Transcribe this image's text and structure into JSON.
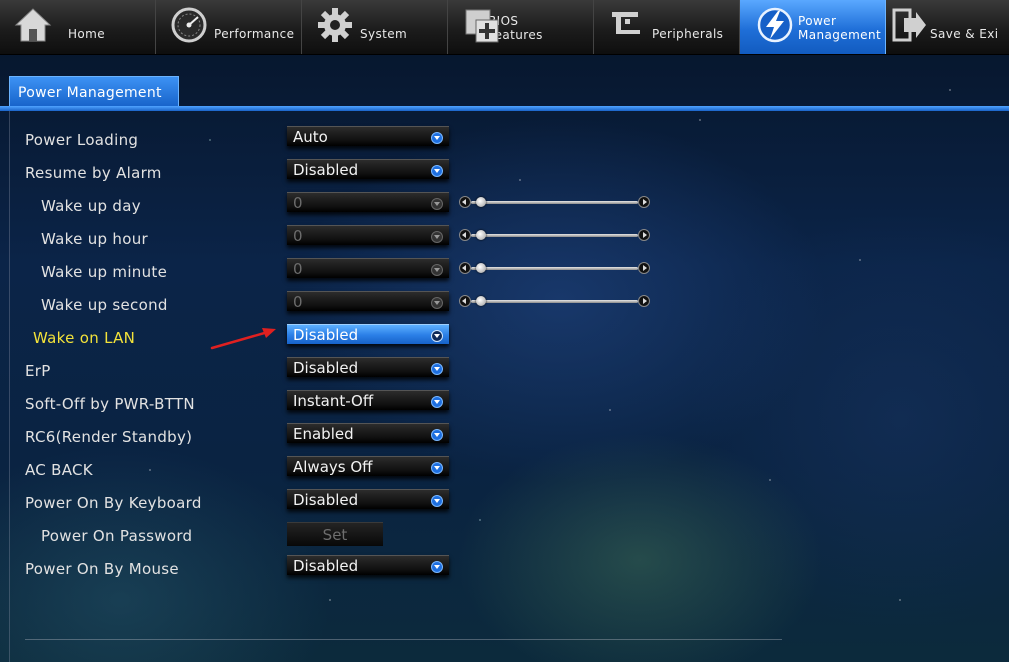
{
  "nav": {
    "tabs": [
      {
        "label1": "Home",
        "label2": ""
      },
      {
        "label1": "Performance",
        "label2": ""
      },
      {
        "label1": "System",
        "label2": ""
      },
      {
        "label1": "BIOS",
        "label2": "Features"
      },
      {
        "label1": "Peripherals",
        "label2": ""
      },
      {
        "label1": "Power",
        "label2": "Management"
      },
      {
        "label1": "Save & Exi",
        "label2": ""
      }
    ],
    "active_index": 5
  },
  "section_tab": "Power Management",
  "settings": [
    {
      "label": "Power Loading",
      "value": "Auto"
    },
    {
      "label": "Resume by Alarm",
      "value": "Disabled"
    },
    {
      "label": "Wake up day",
      "value": "0",
      "slider": 0
    },
    {
      "label": "Wake up hour",
      "value": "0",
      "slider": 0
    },
    {
      "label": "Wake up minute",
      "value": "0",
      "slider": 0
    },
    {
      "label": "Wake up second",
      "value": "0",
      "slider": 0
    },
    {
      "label": "Wake on LAN",
      "value": "Disabled"
    },
    {
      "label": "ErP",
      "value": "Disabled"
    },
    {
      "label": "Soft-Off by PWR-BTTN",
      "value": "Instant-Off"
    },
    {
      "label": "RC6(Render Standby)",
      "value": "Enabled"
    },
    {
      "label": "AC BACK",
      "value": "Always Off"
    },
    {
      "label": "Power On By Keyboard",
      "value": "Disabled"
    },
    {
      "label": "Power On Password",
      "button": "Set"
    },
    {
      "label": "Power On By Mouse",
      "value": "Disabled"
    }
  ],
  "colors": {
    "accent": "#2a7ee6",
    "highlight_label": "#f2e23a",
    "indicator_arrow": "#e02020"
  }
}
